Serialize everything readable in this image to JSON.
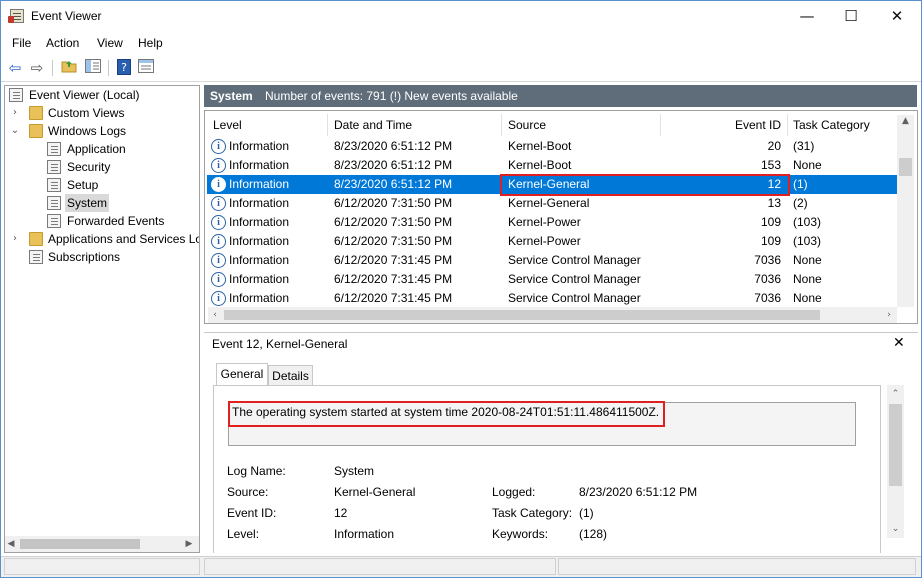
{
  "window": {
    "title": "Event Viewer",
    "minimize": "—",
    "maximize": "☐",
    "close": "✕"
  },
  "menu": [
    "File",
    "Action",
    "View",
    "Help"
  ],
  "tree": {
    "root": "Event Viewer (Local)",
    "custom_views": "Custom Views",
    "windows_logs": "Windows Logs",
    "logs": [
      "Application",
      "Security",
      "Setup",
      "System",
      "Forwarded Events"
    ],
    "app_services": "Applications and Services Lo",
    "subscriptions": "Subscriptions",
    "selected": "System"
  },
  "header": {
    "log_name": "System",
    "summary": "Number of events: 791 (!) New events available"
  },
  "columns": [
    "Level",
    "Date and Time",
    "Source",
    "Event ID",
    "Task Category"
  ],
  "events": [
    {
      "level": "Information",
      "datetime": "8/23/2020 6:51:12 PM",
      "source": "Kernel-Boot",
      "event_id": "20",
      "task_category": "(31)"
    },
    {
      "level": "Information",
      "datetime": "8/23/2020 6:51:12 PM",
      "source": "Kernel-Boot",
      "event_id": "153",
      "task_category": "None"
    },
    {
      "level": "Information",
      "datetime": "8/23/2020 6:51:12 PM",
      "source": "Kernel-General",
      "event_id": "12",
      "task_category": "(1)"
    },
    {
      "level": "Information",
      "datetime": "6/12/2020 7:31:50 PM",
      "source": "Kernel-General",
      "event_id": "13",
      "task_category": "(2)"
    },
    {
      "level": "Information",
      "datetime": "6/12/2020 7:31:50 PM",
      "source": "Kernel-Power",
      "event_id": "109",
      "task_category": "(103)"
    },
    {
      "level": "Information",
      "datetime": "6/12/2020 7:31:50 PM",
      "source": "Kernel-Power",
      "event_id": "109",
      "task_category": "(103)"
    },
    {
      "level": "Information",
      "datetime": "6/12/2020 7:31:45 PM",
      "source": "Service Control Manager",
      "event_id": "7036",
      "task_category": "None"
    },
    {
      "level": "Information",
      "datetime": "6/12/2020 7:31:45 PM",
      "source": "Service Control Manager",
      "event_id": "7036",
      "task_category": "None"
    },
    {
      "level": "Information",
      "datetime": "6/12/2020 7:31:45 PM",
      "source": "Service Control Manager",
      "event_id": "7036",
      "task_category": "None"
    }
  ],
  "selected_index": 2,
  "detail": {
    "title": "Event 12, Kernel-General",
    "tabs": [
      "General",
      "Details"
    ],
    "active_tab": "General",
    "message": "The operating system started at system time 2020-08-24T01:51:11.486411500Z.",
    "labels": {
      "log_name": "Log Name:",
      "source": "Source:",
      "event_id": "Event ID:",
      "level": "Level:",
      "logged": "Logged:",
      "task_category": "Task Category:",
      "keywords": "Keywords:"
    },
    "values": {
      "log_name": "System",
      "source": "Kernel-General",
      "event_id": "12",
      "level": "Information",
      "logged": "8/23/2020 6:51:12 PM",
      "task_category": "(1)",
      "keywords": "(128)"
    }
  },
  "colors": {
    "selection": "#0078d7",
    "header_bar": "#5f6d7a",
    "highlight": "#e02020"
  }
}
